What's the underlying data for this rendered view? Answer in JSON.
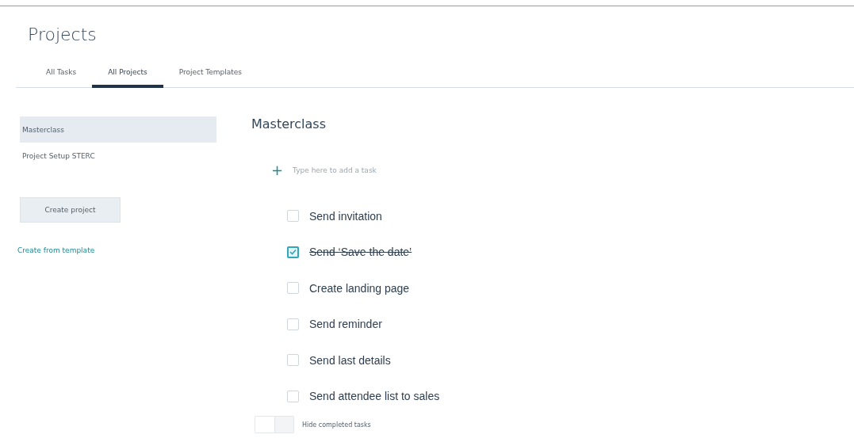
{
  "header": {
    "title": "Projects"
  },
  "tabs": [
    {
      "label": "All Tasks",
      "selected": false
    },
    {
      "label": "All Projects",
      "selected": true
    },
    {
      "label": "Project Templates",
      "selected": false
    }
  ],
  "sidebar": {
    "items": [
      {
        "label": "Masterclass",
        "selected": true
      },
      {
        "label": "Project Setup STERC",
        "selected": false
      }
    ],
    "create_button": "Create project",
    "template_link": "Create from template"
  },
  "project": {
    "title": "Masterclass",
    "add_task": {
      "icon": "+",
      "placeholder": "Type here to add a task"
    },
    "tasks": [
      {
        "label": "Send invitation",
        "checked": false
      },
      {
        "label": "Send ‘Save the date’",
        "checked": true
      },
      {
        "label": "Create landing page",
        "checked": false
      },
      {
        "label": "Send reminder",
        "checked": false
      },
      {
        "label": "Send last details",
        "checked": false
      },
      {
        "label": "Send attendee list to sales",
        "checked": false
      }
    ],
    "hide_completed": {
      "label": "Hide completed tasks",
      "on": false
    }
  }
}
